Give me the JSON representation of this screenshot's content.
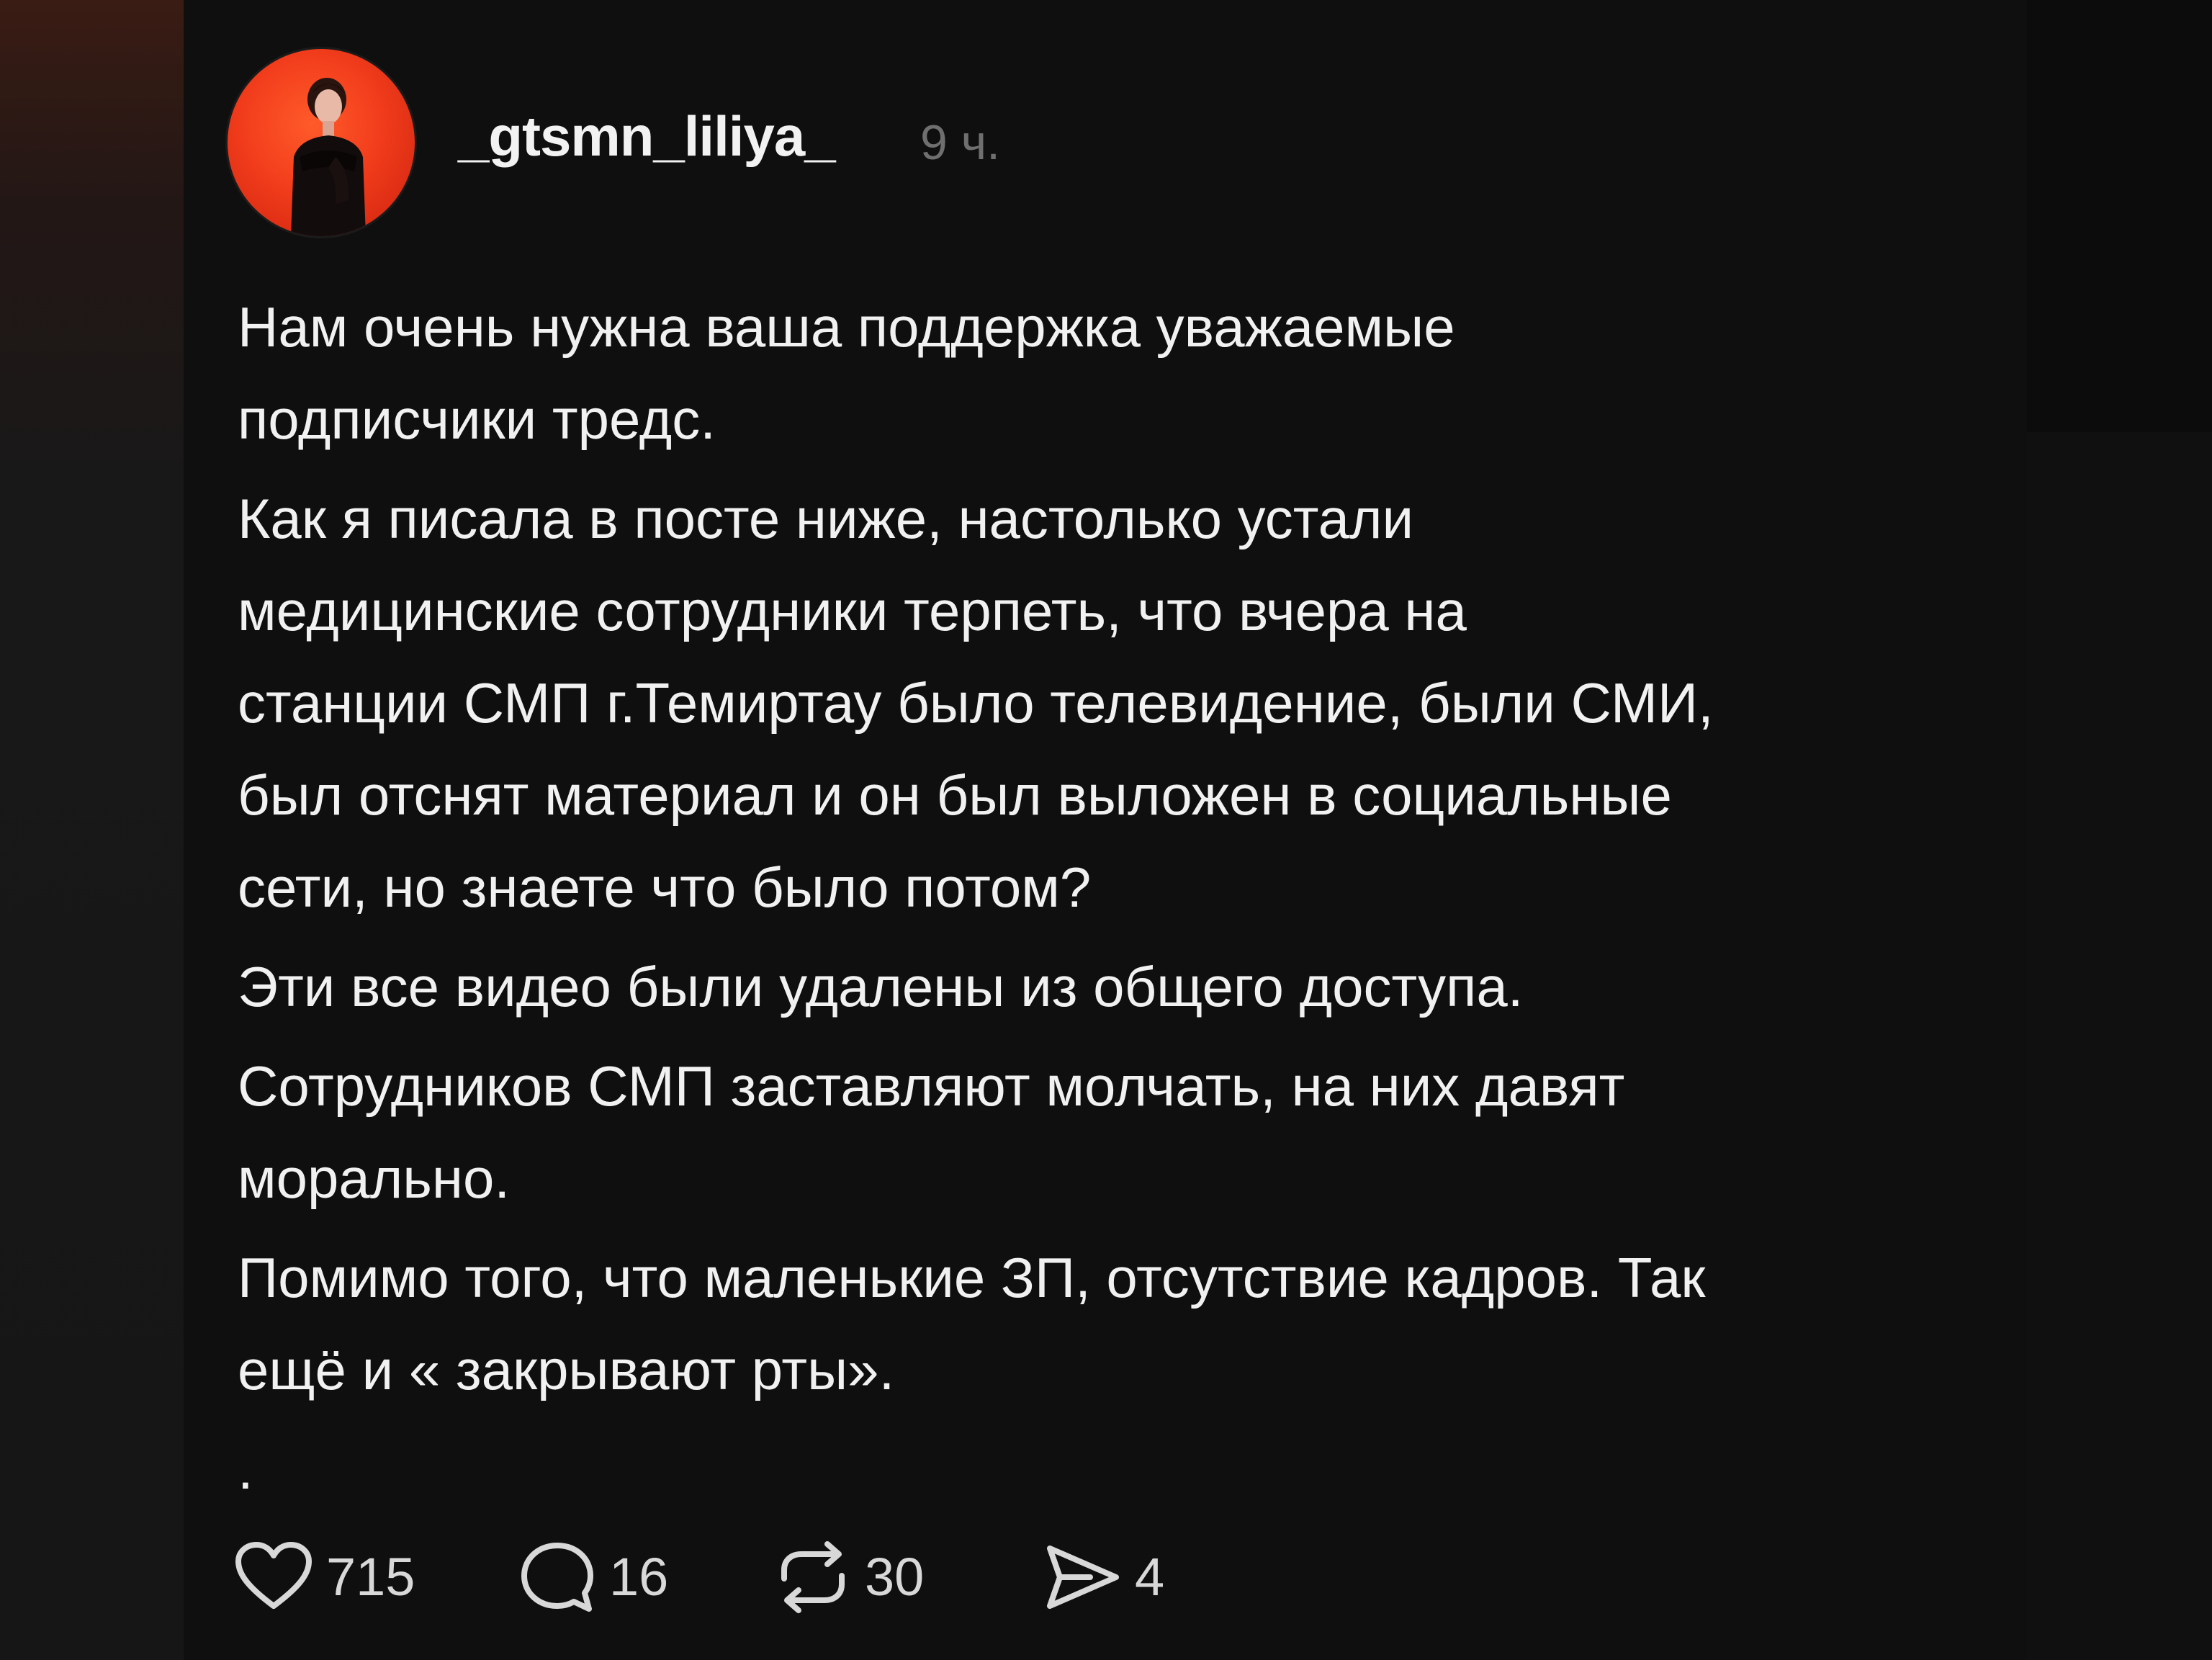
{
  "post": {
    "username": "_gtsmn_liliya_",
    "time": "9 ч.",
    "paragraphs": [
      "Нам очень нужна ваша поддержка уважаемые\nподписчики тредс.",
      "Как я писала в посте ниже, настолько устали\nмедицинские сотрудники терпеть, что вчера на\nстанции СМП г.Темиртау было телевидение, были СМИ,\nбыл отснят материал и он был выложен в социальные\nсети, но знаете что было потом?",
      "Эти все видео были удалены из общего доступа.",
      "Сотрудников СМП заставляют молчать, на них давят\nморально.",
      "Помимо того, что маленькие ЗП, отсутствие кадров. Так\nещё и « закрывают рты».",
      "."
    ]
  },
  "actions": {
    "likes": "715",
    "replies": "16",
    "reposts": "30",
    "shares": "4"
  },
  "icons": {
    "like": "heart-icon",
    "reply": "speech-bubble-icon",
    "repost": "repost-arrows-icon",
    "share": "paper-plane-icon"
  },
  "colors": {
    "background": "#0f0f0f",
    "text": "#f1f1f1",
    "muted": "#6f6f6f",
    "avatar_bg": "#f23d1c"
  }
}
